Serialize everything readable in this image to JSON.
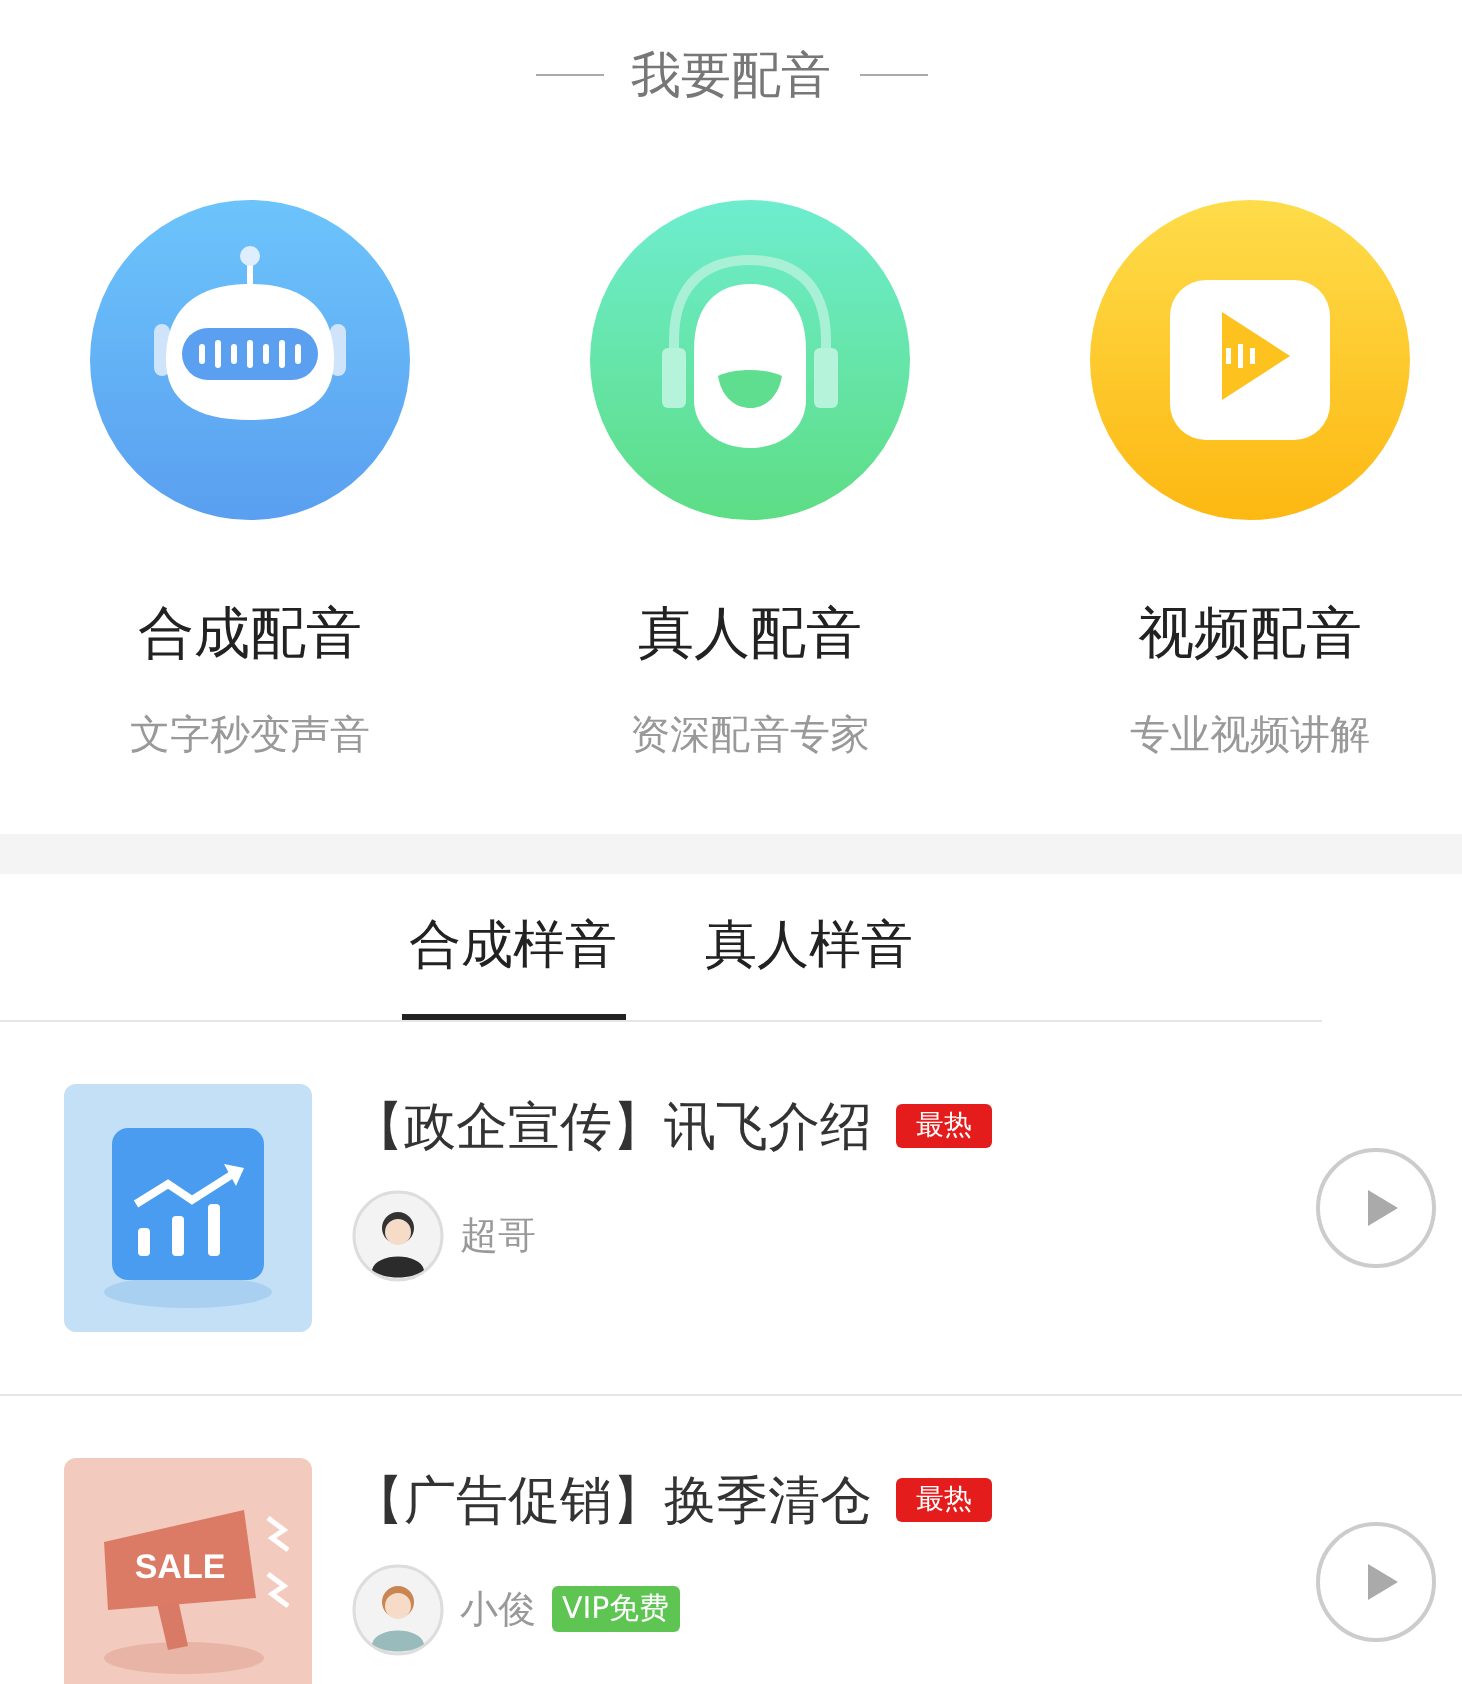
{
  "section_title": "我要配音",
  "services": [
    {
      "kind": "robot",
      "title": "合成配音",
      "subtitle": "文字秒变声音"
    },
    {
      "kind": "headset",
      "title": "真人配音",
      "subtitle": "资深配音专家"
    },
    {
      "kind": "video",
      "title": "视频配音",
      "subtitle": "专业视频讲解"
    }
  ],
  "tabs": [
    {
      "label": "合成样音",
      "selected": true
    },
    {
      "label": "真人样音",
      "selected": false
    }
  ],
  "samples": [
    {
      "kind": "chart",
      "title": "【政企宣传】讯飞介绍",
      "badge": "最热",
      "voice": "超哥"
    },
    {
      "kind": "sale",
      "thumbnail_text": "SALE",
      "title": "【广告促销】换季清仓",
      "badge": "最热",
      "voice": "小俊",
      "tag": "VIP免费"
    }
  ]
}
